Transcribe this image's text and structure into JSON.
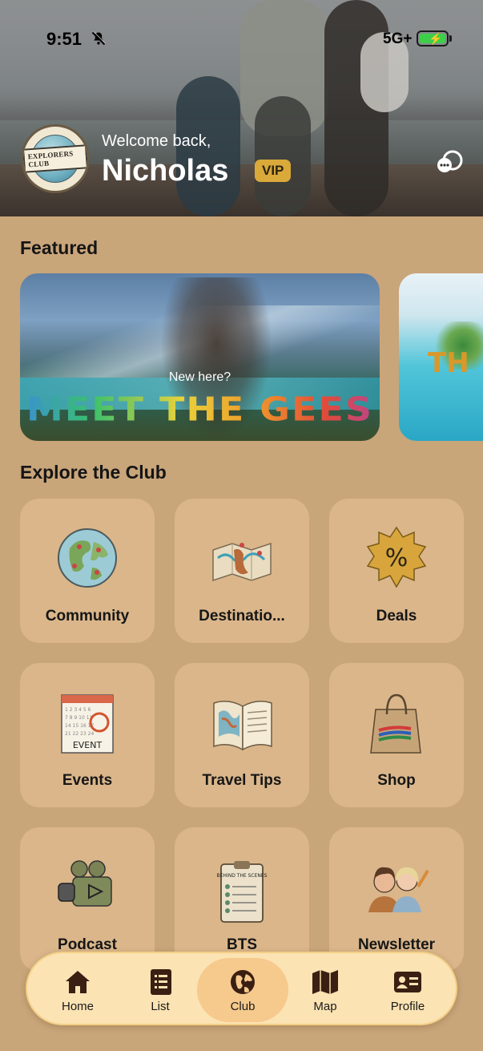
{
  "status_bar": {
    "time": "9:51",
    "network": "5G+",
    "icons": [
      "bell-slash-icon",
      "battery-charging-icon"
    ]
  },
  "header": {
    "logo_text": "EXPLORERS CLUB",
    "welcome": "Welcome back,",
    "username": "Nicholas",
    "badge": "VIP",
    "chat_icon": "chat-bubbles-icon"
  },
  "featured": {
    "title": "Featured",
    "cards": [
      {
        "subtitle": "New here?",
        "title": "MEET THE GEES"
      },
      {
        "title": "TH"
      }
    ]
  },
  "explore": {
    "title": "Explore the Club",
    "tiles": [
      {
        "label": "Community",
        "icon": "globe-icon"
      },
      {
        "label": "Destinatio...",
        "icon": "map-icon"
      },
      {
        "label": "Deals",
        "icon": "percent-badge-icon"
      },
      {
        "label": "Events",
        "icon": "calendar-icon",
        "icon_text": "EVENT"
      },
      {
        "label": "Travel Tips",
        "icon": "open-book-icon"
      },
      {
        "label": "Shop",
        "icon": "shopping-bag-icon"
      },
      {
        "label": "Podcast",
        "icon": "video-camera-icon"
      },
      {
        "label": "BTS",
        "icon": "clipboard-icon",
        "icon_text": "BEHIND THE SCENES"
      },
      {
        "label": "Newsletter",
        "icon": "people-pencil-icon"
      }
    ]
  },
  "nav": {
    "active": "Club",
    "items": [
      {
        "label": "Home",
        "icon": "home-icon"
      },
      {
        "label": "List",
        "icon": "list-icon"
      },
      {
        "label": "Club",
        "icon": "globe-icon"
      },
      {
        "label": "Map",
        "icon": "map-icon"
      },
      {
        "label": "Profile",
        "icon": "id-card-icon"
      }
    ]
  },
  "colors": {
    "background": "#c9a57a",
    "tile": "#e7c498",
    "nav_bg": "#fbe3b3",
    "nav_active": "#f6c98d",
    "vip": "#d9a93a"
  }
}
